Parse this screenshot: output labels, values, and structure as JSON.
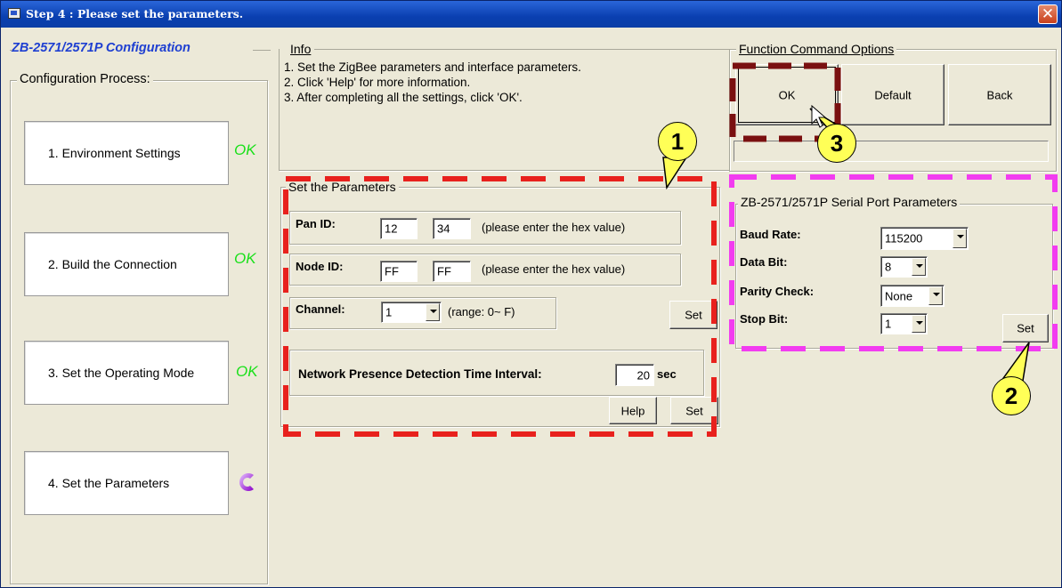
{
  "window": {
    "title": "Step 4 : Please set the parameters.",
    "close_label": "✕"
  },
  "left": {
    "header": "ZB-2571/2571P Configuration",
    "process_legend": "Configuration Process:",
    "steps": [
      {
        "label": "1. Environment Settings",
        "status": "OK"
      },
      {
        "label": "2. Build the Connection",
        "status": "OK"
      },
      {
        "label": "3. Set the Operating Mode",
        "status": "OK"
      },
      {
        "label": "4. Set the Parameters",
        "status": ""
      }
    ]
  },
  "info": {
    "legend": "Info",
    "lines": [
      "1. Set the ZigBee parameters and interface parameters.",
      "2. Click 'Help' for more information.",
      "3. After completing all the settings, click 'OK'."
    ]
  },
  "function": {
    "legend": "Function Command Options",
    "ok_label": "OK",
    "default_label": "Default",
    "back_label": "Back"
  },
  "params": {
    "legend": "Set the Parameters",
    "pan_label": "Pan ID:",
    "pan_values": [
      "12",
      "34"
    ],
    "pan_hint": "(please enter the hex value)",
    "node_label": "Node ID:",
    "node_values": [
      "FF",
      "FF"
    ],
    "node_hint": "(please enter the hex value)",
    "channel_label": "Channel:",
    "channel_value": "1",
    "channel_hint": "(range: 0~ F)",
    "channel_set_label": "Set",
    "net_label": "Network Presence Detection Time Interval:",
    "net_value": "20",
    "net_unit": "sec",
    "help_label": "Help",
    "set_label": "Set"
  },
  "serial": {
    "legend": "ZB-2571/2571P Serial Port Parameters",
    "baud_label": "Baud Rate:",
    "baud_value": "115200",
    "data_label": "Data Bit:",
    "data_value": "8",
    "parity_label": "Parity Check:",
    "parity_value": "None",
    "stop_label": "Stop Bit:",
    "stop_value": "1",
    "set_label": "Set"
  },
  "callouts": [
    "1",
    "2",
    "3"
  ],
  "colors": {
    "callout_fill": "#ffff57",
    "highlight_red": "#e8211d",
    "highlight_magenta": "#f23cf0",
    "highlight_darkred": "#7a1010",
    "ok_green": "#19e019"
  }
}
